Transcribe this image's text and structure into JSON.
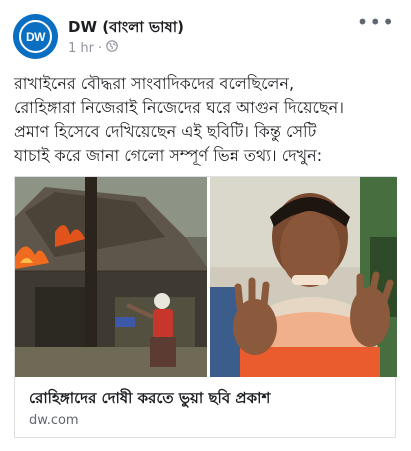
{
  "post": {
    "page_name": "DW (বাংলা ভাষা)",
    "avatar_text": "DW",
    "time": "1 hr",
    "separator": "·",
    "privacy_icon": "globe-icon",
    "more_icon": "more-options-icon",
    "more_label": "•••",
    "text_lines": [
      "রাখাইনের বৌদ্ধরা সাংবাদিকদের বলেছিলেন,",
      "রোহিঙ্গারা নিজেরাই নিজেদের ঘরে আগুন দিয়েছেন।",
      "প্রমাণ হিসেবে দেখিয়েছেন এই ছবিটি। কিন্তু সেটি",
      "যাচাই করে জানা গেলো সম্পূর্ণ ভিন্ন তথ্য। দেখুন:"
    ]
  },
  "link_card": {
    "title": "রোহিঙ্গাদের দোষী করতে ভুয়া ছবি প্রকাশ",
    "domain": "dw.com"
  },
  "colors": {
    "brand_blue": "#0a6fc2",
    "meta_gray": "#90949c",
    "border": "#dddfe2"
  }
}
